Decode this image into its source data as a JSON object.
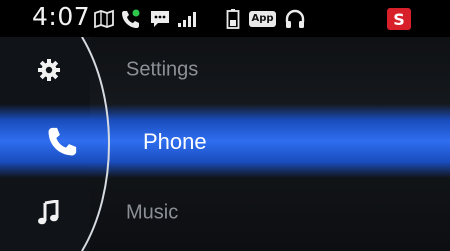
{
  "status_bar": {
    "time": "4:07",
    "icons": [
      "navigation-icon",
      "phone-call-icon",
      "message-icon",
      "signal-icon",
      "battery-icon",
      "app-icon",
      "headphones-icon",
      "siriusxm-icon"
    ],
    "app_badge": "App",
    "s_badge": "S"
  },
  "menu": {
    "items": [
      {
        "label": "Settings",
        "icon": "gear-icon",
        "selected": false
      },
      {
        "label": "Phone",
        "icon": "phone-icon",
        "selected": true
      },
      {
        "label": "Music",
        "icon": "music-note-icon",
        "selected": false
      }
    ]
  },
  "colors": {
    "highlight": "#2f6ef0",
    "badge_red": "#d8202b",
    "call_green": "#2ec84a",
    "inactive_text": "#8c9096"
  }
}
